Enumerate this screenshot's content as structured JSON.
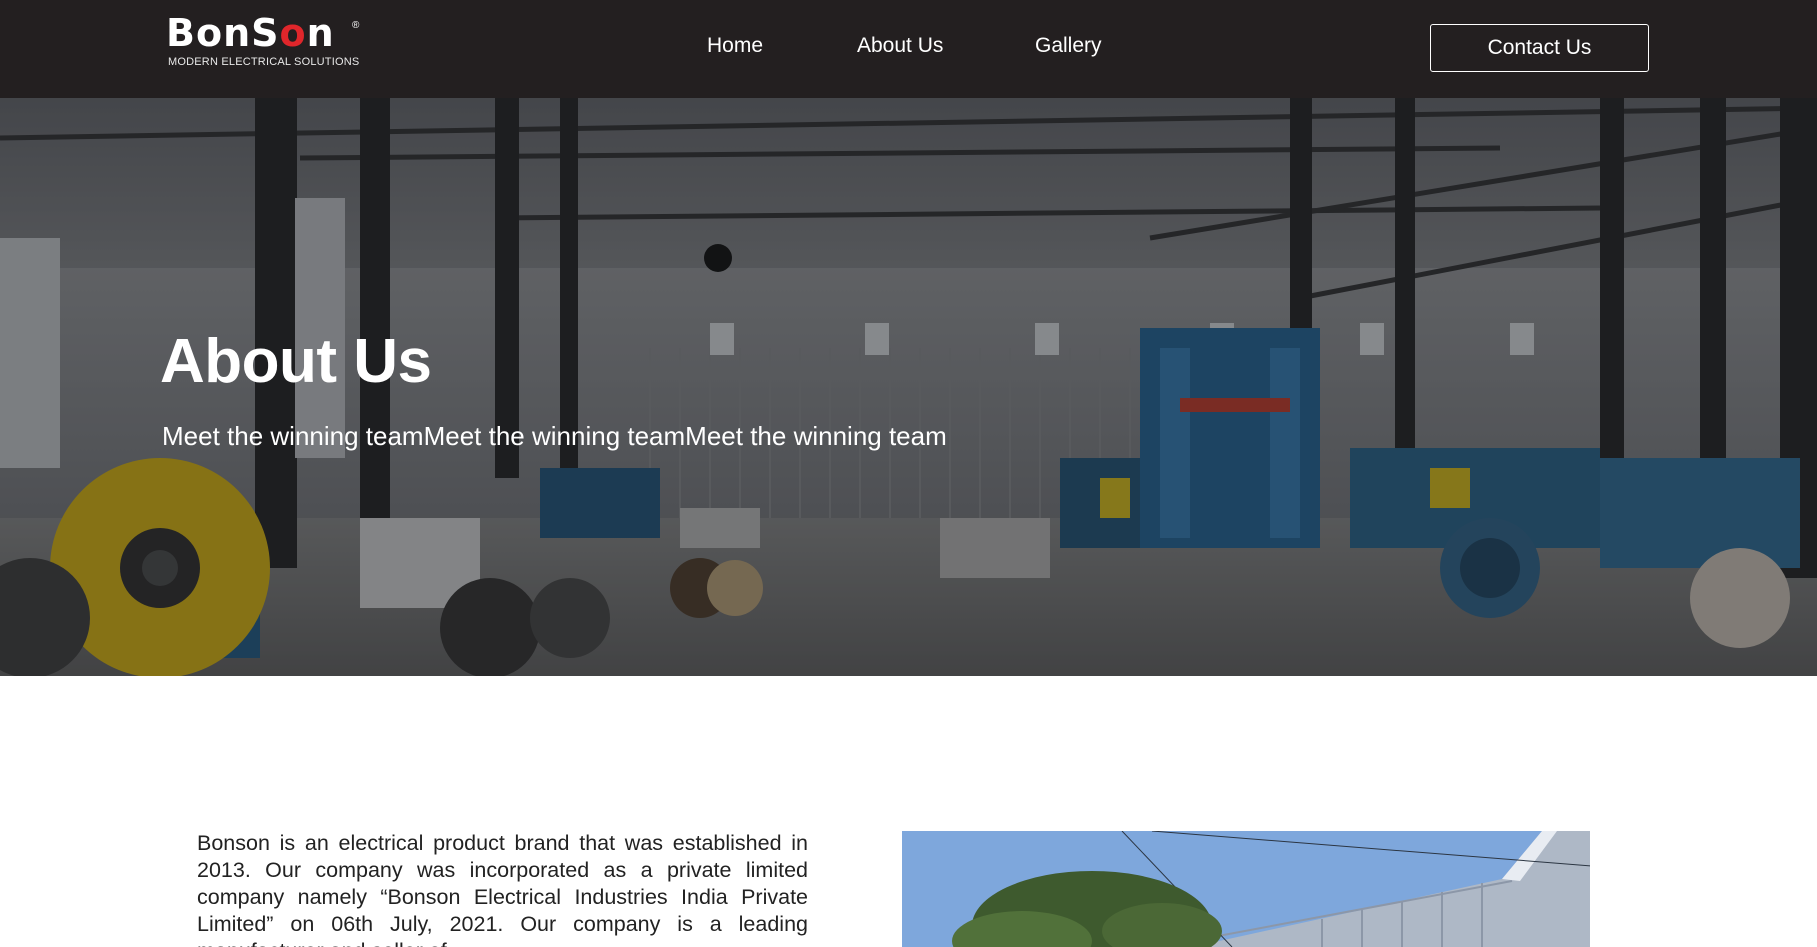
{
  "header": {
    "logo": {
      "word_main": "BonS",
      "word_accent": "o",
      "word_end": "n",
      "registered": "®",
      "tagline": "MODERN ELECTRICAL SOLUTIONS"
    },
    "nav": {
      "home": "Home",
      "about": "About Us",
      "gallery": "Gallery"
    },
    "contact_label": "Contact Us"
  },
  "hero": {
    "title": "About Us",
    "subtitle": "Meet the winning teamMeet the winning teamMeet the winning team"
  },
  "content": {
    "intro": "Bonson is an electrical product brand that was established in 2013. Our company was incorporated as a private limited company namely “Bonson Electrical Industries India Private Limited” on 06th July, 2021. Our company is a leading manufacturer and seller of"
  },
  "colors": {
    "header_bg": "#231f20",
    "brand_red": "#e0262b",
    "text_dark": "#222222",
    "white": "#ffffff"
  }
}
